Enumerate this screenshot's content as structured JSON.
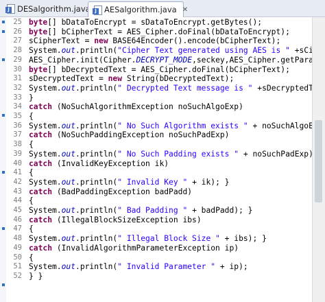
{
  "tabs": [
    {
      "label": "DESalgorithm.java",
      "active": false
    },
    {
      "label": "AESalgorithm.java",
      "active": true,
      "close": "✕"
    }
  ],
  "line_numbers": [
    "25",
    "26",
    "27",
    "28",
    "29",
    "30",
    "31",
    "32",
    "33",
    "34",
    "35",
    "36",
    "37",
    "38",
    "39",
    "40",
    "41",
    "42",
    "43",
    "44",
    "45",
    "46",
    "47",
    "48",
    "49",
    "50",
    "51",
    "52"
  ],
  "code_lines": [
    [
      [
        "kw",
        "byte"
      ],
      [
        "",
        "[] bDataToEncrypt = sDataToEncrypt.getBytes();"
      ]
    ],
    [
      [
        "kw",
        "byte"
      ],
      [
        "",
        "[] bCipherText = AES_Cipher.doFinal(bDataToEncrypt);"
      ]
    ],
    [
      [
        "",
        "sCipherText = "
      ],
      [
        "kw",
        "new"
      ],
      [
        "",
        " BASE64Encoder().encode(bCipherText);"
      ]
    ],
    [
      [
        "",
        "System."
      ],
      [
        "fld",
        "out"
      ],
      [
        "",
        ".println("
      ],
      [
        "st",
        "\"Cipher Text generated using AES is \""
      ],
      [
        "",
        " +sCipherText);"
      ]
    ],
    [
      [
        "",
        "AES_Cipher.init(Cipher."
      ],
      [
        "fld",
        "DECRYPT_MODE"
      ],
      [
        "",
        ",seckey,AES_Cipher.getParameters());"
      ]
    ],
    [
      [
        "kw",
        "byte"
      ],
      [
        "",
        "[] bDecryptedText = AES_Cipher.doFinal(bCipherText);"
      ]
    ],
    [
      [
        "",
        "sDecryptedText = "
      ],
      [
        "kw",
        "new"
      ],
      [
        "",
        " String(bDecryptedText);"
      ]
    ],
    [
      [
        "",
        "System."
      ],
      [
        "fld",
        "out"
      ],
      [
        "",
        ".println("
      ],
      [
        "st",
        "\" Decrypted Text message is \""
      ],
      [
        "",
        " +sDecryptedText);"
      ]
    ],
    [
      [
        "",
        "}"
      ]
    ],
    [
      [
        "kw",
        "catch"
      ],
      [
        "",
        " (NoSuchAlgorithmException noSuchAlgoExp)"
      ]
    ],
    [
      [
        "",
        "{"
      ]
    ],
    [
      [
        "",
        "System."
      ],
      [
        "fld",
        "out"
      ],
      [
        "",
        ".println("
      ],
      [
        "st",
        "\" No Such Algorithm exists \""
      ],
      [
        "",
        " + noSuchAlgoExp);"
      ]
    ],
    [
      [
        "kw",
        "catch"
      ],
      [
        "",
        " (NoSuchPaddingException noSuchPadExp)"
      ]
    ],
    [
      [
        "",
        "{"
      ]
    ],
    [
      [
        "",
        "System."
      ],
      [
        "fld",
        "out"
      ],
      [
        "",
        ".println("
      ],
      [
        "st",
        "\" No Such Padding exists \""
      ],
      [
        "",
        " + noSuchPadExp);"
      ]
    ],
    [
      [
        "kw",
        "catch"
      ],
      [
        "",
        " (InvalidKeyException ik)"
      ]
    ],
    [
      [
        "",
        "{"
      ]
    ],
    [
      [
        "",
        "System."
      ],
      [
        "fld",
        "out"
      ],
      [
        "",
        ".println("
      ],
      [
        "st",
        "\" Invalid Key \""
      ],
      [
        "",
        " + ik); }"
      ]
    ],
    [
      [
        "kw",
        "catch"
      ],
      [
        "",
        " (BadPaddingException badPadd)"
      ]
    ],
    [
      [
        "",
        "{"
      ]
    ],
    [
      [
        "",
        "System."
      ],
      [
        "fld",
        "out"
      ],
      [
        "",
        ".println("
      ],
      [
        "st",
        "\" Bad Padding \""
      ],
      [
        "",
        " + badPadd); }"
      ]
    ],
    [
      [
        "kw",
        "catch"
      ],
      [
        "",
        " (IllegalBlockSizeException ibs)"
      ]
    ],
    [
      [
        "",
        "{"
      ]
    ],
    [
      [
        "",
        "System."
      ],
      [
        "fld",
        "out"
      ],
      [
        "",
        ".println("
      ],
      [
        "st",
        "\" Illegal Block Size \""
      ],
      [
        "",
        " + ibs); }"
      ]
    ],
    [
      [
        "kw",
        "catch"
      ],
      [
        "",
        " (InvalidAlgorithmParameterException ip)"
      ]
    ],
    [
      [
        "",
        "{"
      ]
    ],
    [
      [
        "",
        "System."
      ],
      [
        "fld",
        "out"
      ],
      [
        "",
        ".println("
      ],
      [
        "st",
        "\" Invalid Parameter \""
      ],
      [
        "",
        " + ip);"
      ]
    ],
    [
      [
        "",
        "} }"
      ]
    ]
  ]
}
